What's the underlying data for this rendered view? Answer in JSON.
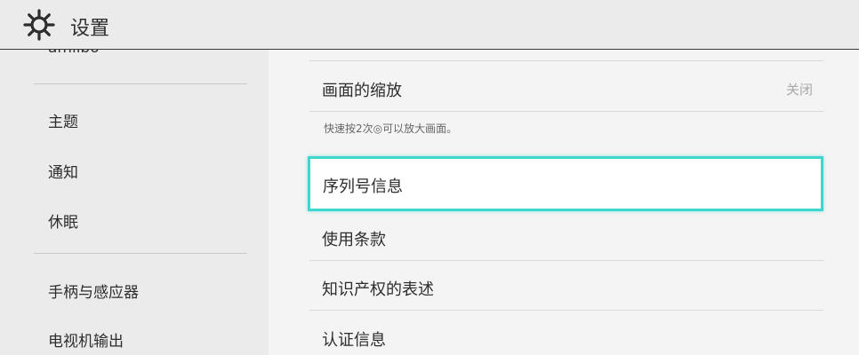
{
  "header": {
    "title": "设置",
    "icon": "gear-icon"
  },
  "sidebar": {
    "cut_item": "amiibo",
    "items": [
      {
        "label": "主题"
      },
      {
        "label": "通知"
      },
      {
        "label": "休眠"
      },
      {
        "label": "手柄与感应器"
      },
      {
        "label": "电视机输出"
      }
    ]
  },
  "main": {
    "zoom": {
      "label": "画面的缩放",
      "value": "关闭",
      "hint": "快速按2次◎可以放大画面。"
    },
    "serial": {
      "label": "序列号信息"
    },
    "terms": {
      "label": "使用条款"
    },
    "ip": {
      "label": "知识产权的表述"
    },
    "cert": {
      "label": "认证信息"
    }
  },
  "colors": {
    "accent": "#3fd6cf",
    "background": "#ebebeb",
    "panel": "#f4f4f4"
  }
}
